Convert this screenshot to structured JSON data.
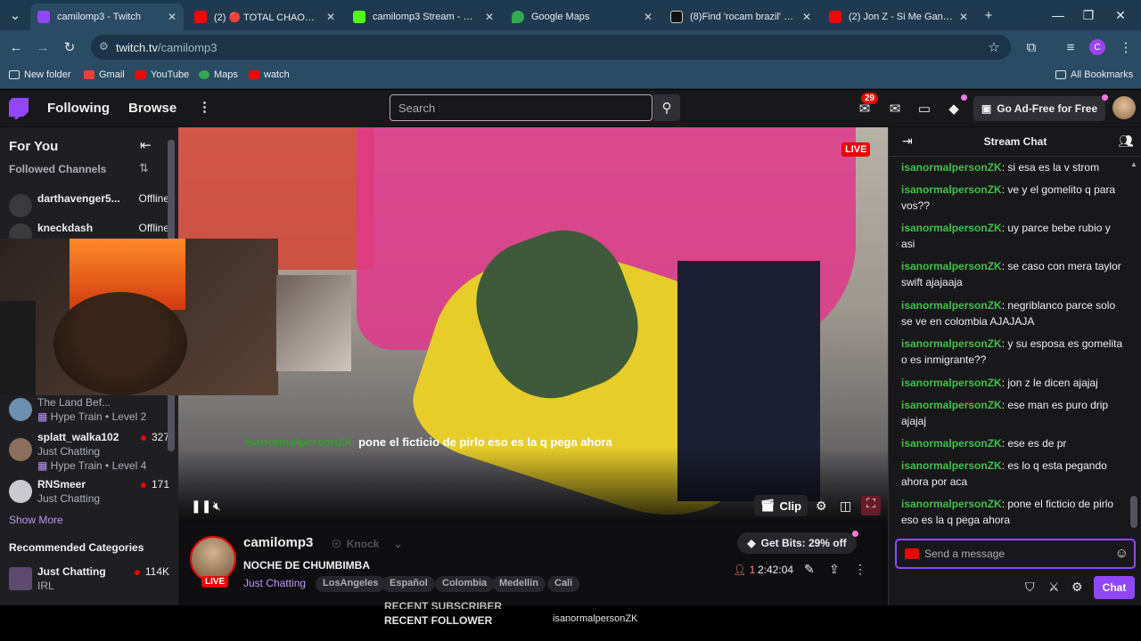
{
  "browser": {
    "tabs": [
      {
        "label": "camilomp3 - Twitch",
        "icon": "twitch-icon",
        "color": "#9147ff",
        "active": true
      },
      {
        "label": "(2) 🔴 TOTAL CHAOS! Fam",
        "icon": "youtube-icon",
        "color": "#ff0000"
      },
      {
        "label": "camilomp3 Stream - Watc",
        "icon": "kick-icon",
        "color": "#53fc18"
      },
      {
        "label": "Google Maps",
        "icon": "maps-icon",
        "color": "#34a853"
      },
      {
        "label": "(8)Find 'rocam brazil' on Ti",
        "icon": "tiktok-icon",
        "color": "#000000"
      },
      {
        "label": "(2) Jon Z - Si Me Gano Un",
        "icon": "youtube-icon",
        "color": "#ff0000"
      }
    ],
    "url_host": "twitch.tv",
    "url_path": "/camilomp3",
    "profile_letter": "C",
    "bookmarks": [
      "New folder",
      "Gmail",
      "YouTube",
      "Maps",
      "watch"
    ],
    "all_bookmarks": "All Bookmarks"
  },
  "twitch": {
    "nav": {
      "following": "Following",
      "browse": "Browse",
      "search_placeholder": "Search",
      "notif_count": "29",
      "ad_free": "Go Ad-Free for Free"
    },
    "sidebar": {
      "for_you": "For You",
      "followed_channels": "Followed Channels",
      "channels_top": [
        {
          "name": "darthavenger5...",
          "status": "Offline"
        },
        {
          "name": "kneckdash",
          "status": "Offline"
        }
      ],
      "channels_bottom": [
        {
          "name": "The Land Bef...",
          "sub": "Hype Train • Level 2",
          "viewers": ""
        },
        {
          "name": "splatt_walka102",
          "sub": "Just Chatting",
          "sub2": "Hype Train • Level 4",
          "viewers": "327"
        },
        {
          "name": "RNSmeer",
          "sub": "Just Chatting",
          "viewers": "171"
        }
      ],
      "show_more": "Show More",
      "recommended_categories": "Recommended Categories",
      "categories": [
        {
          "name": "Just Chatting",
          "sub": "IRL",
          "viewers": "114K"
        }
      ]
    },
    "video": {
      "live_label": "LIVE",
      "overlay_user": "isanormalpersonZK",
      "overlay_msg": "pone el ficticio de pirlo eso es la q pega ahora",
      "clip": "Clip"
    },
    "channel": {
      "name": "camilomp3",
      "knock": "Knock",
      "title": "NOCHE DE CHUMBIMBA",
      "category": "Just Chatting",
      "tags": [
        "LosAngeles",
        "Español",
        "Colombia",
        "Medellin",
        "Cali"
      ],
      "live": "LIVE",
      "get_bits": "Get Bits: 29% off",
      "viewers": "1",
      "uptime": "2:42:04"
    },
    "chat": {
      "title": "Stream Chat",
      "messages": [
        {
          "user": "isanormalpersonZK",
          "text": "si esa es la v strom"
        },
        {
          "user": "isanormalpersonZK",
          "text": "ve y el gomelito q para vos??"
        },
        {
          "user": "isanormalpersonZK",
          "text": "uy parce bebe rubio y asi"
        },
        {
          "user": "isanormalpersonZK",
          "text": "se caso con mera taylor swift ajajaaja"
        },
        {
          "user": "isanormalpersonZK",
          "text": "negriblanco parce solo se ve en colombia AJAJAJA"
        },
        {
          "user": "isanormalpersonZK",
          "text": "y su esposa es gomelita o es inmigrante??"
        },
        {
          "user": "isanormalpersonZK",
          "text": "jon z le dicen ajajaj"
        },
        {
          "user": "isanormalpersonZK",
          "text": "ese man es puro drip ajajaj"
        },
        {
          "user": "isanormalpersonZK",
          "text": "ese es de pr"
        },
        {
          "user": "isanormalpersonZK",
          "text": "es lo q esta pegando ahora por aca"
        },
        {
          "user": "isanormalpersonZK",
          "text": "pone el ficticio de pirlo eso es la q pega ahora"
        }
      ],
      "input_placeholder": "Send a message",
      "chat_button": "Chat"
    }
  },
  "overlay_bottom": {
    "recent_subscriber": "RECENT SUBSCRIBER",
    "recent_follower": "RECENT FOLLOWER",
    "follower_name": "isanormalpersonZK"
  }
}
